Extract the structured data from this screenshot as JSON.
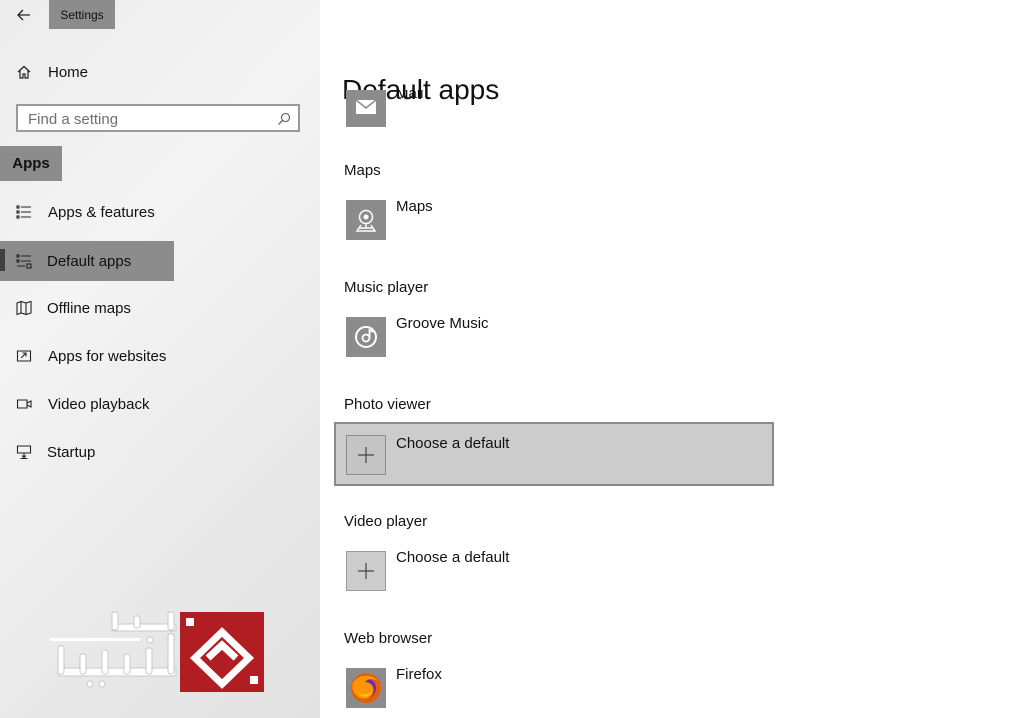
{
  "window": {
    "title": "Settings"
  },
  "sidebar": {
    "home_label": "Home",
    "search_placeholder": "Find a setting",
    "section_label": "Apps",
    "items": [
      {
        "label": "Apps & features",
        "icon": "list-icon"
      },
      {
        "label": "Default apps",
        "icon": "default-apps-icon",
        "selected": true
      },
      {
        "label": "Offline maps",
        "icon": "map-icon"
      },
      {
        "label": "Apps for websites",
        "icon": "open-link-icon"
      },
      {
        "label": "Video playback",
        "icon": "video-camera-icon"
      },
      {
        "label": "Startup",
        "icon": "startup-icon"
      }
    ]
  },
  "main": {
    "title": "Default apps",
    "categories": [
      {
        "label": "",
        "app": "Mail",
        "icon": "mail-icon"
      },
      {
        "label": "Maps",
        "app": "Maps",
        "icon": "maps-icon"
      },
      {
        "label": "Music player",
        "app": "Groove Music",
        "icon": "groove-music-icon"
      },
      {
        "label": "Photo viewer",
        "app": "Choose a default",
        "icon": "plus-icon",
        "selected": true
      },
      {
        "label": "Video player",
        "app": "Choose a default",
        "icon": "plus-icon"
      },
      {
        "label": "Web browser",
        "app": "Firefox",
        "icon": "firefox-icon"
      }
    ]
  },
  "colors": {
    "selected_bg": "#8c8c8c",
    "tile_selected_bg": "#cccccc",
    "icon_tile_bg": "#8c8c8c",
    "watermark_red": "#b01e23"
  }
}
